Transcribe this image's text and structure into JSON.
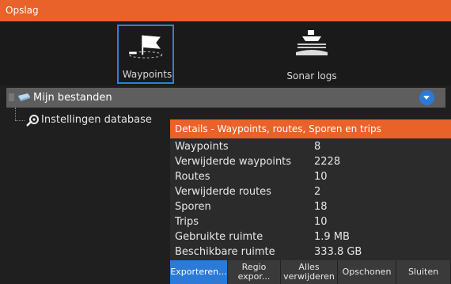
{
  "title": "Opslag",
  "tiles": [
    {
      "label": "Waypoints",
      "selected": true,
      "icon": "waypoint-flag-icon"
    },
    {
      "label": "Sonar logs",
      "selected": false,
      "icon": "sonar-boat-icon"
    }
  ],
  "files": {
    "label": "Mijn bestanden",
    "icon": "disk-icon",
    "dropdown_icon": "chevron-down-icon"
  },
  "database": {
    "label": "Instellingen database",
    "icon": "settings-tools-icon"
  },
  "dialog": {
    "title": "Details - Waypoints, routes, Sporen en trips",
    "rows": [
      {
        "key": "Waypoints",
        "value": "8"
      },
      {
        "key": "Verwijderde waypoints",
        "value": "2228"
      },
      {
        "key": "Routes",
        "value": "10"
      },
      {
        "key": "Verwijderde routes",
        "value": "2"
      },
      {
        "key": "Sporen",
        "value": "18"
      },
      {
        "key": "Trips",
        "value": "10"
      },
      {
        "key": "Gebruikte ruimte",
        "value": "1.9 MB"
      },
      {
        "key": "Beschikbare ruimte",
        "value": "333.8 GB"
      }
    ],
    "actions": [
      "Exporteren...",
      "Regio expor...",
      "Alles verwijderen",
      "Opschonen",
      "Sluiten"
    ]
  },
  "colors": {
    "accent": "#e8622a",
    "selection": "#2b7ad8"
  }
}
